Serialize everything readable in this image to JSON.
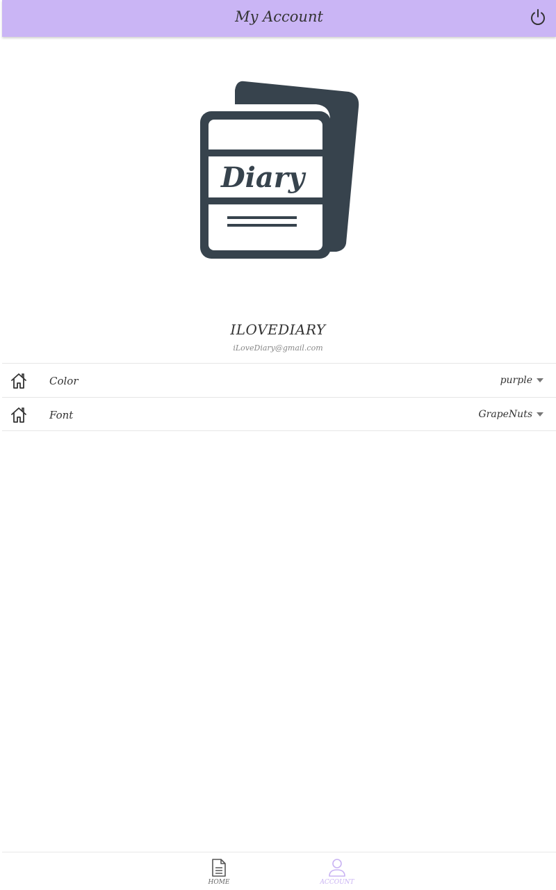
{
  "header": {
    "title": "My Account",
    "power_icon": "power-icon",
    "color": "#cab5f5"
  },
  "logo": {
    "text": "Diary",
    "color": "#37434d"
  },
  "profile": {
    "name": "ILOVEDIARY",
    "email": "iLoveDiary@gmail.com"
  },
  "settings": {
    "items": [
      {
        "icon": "home-icon",
        "label": "Color",
        "value": "purple"
      },
      {
        "icon": "home-icon",
        "label": "Font",
        "value": "GrapeNuts"
      }
    ]
  },
  "bottom_nav": {
    "items": [
      {
        "icon": "document-icon",
        "label": "HOME",
        "active": false
      },
      {
        "icon": "person-icon",
        "label": "ACCOUNT",
        "active": true
      }
    ],
    "active_color": "#c9b3f3"
  }
}
